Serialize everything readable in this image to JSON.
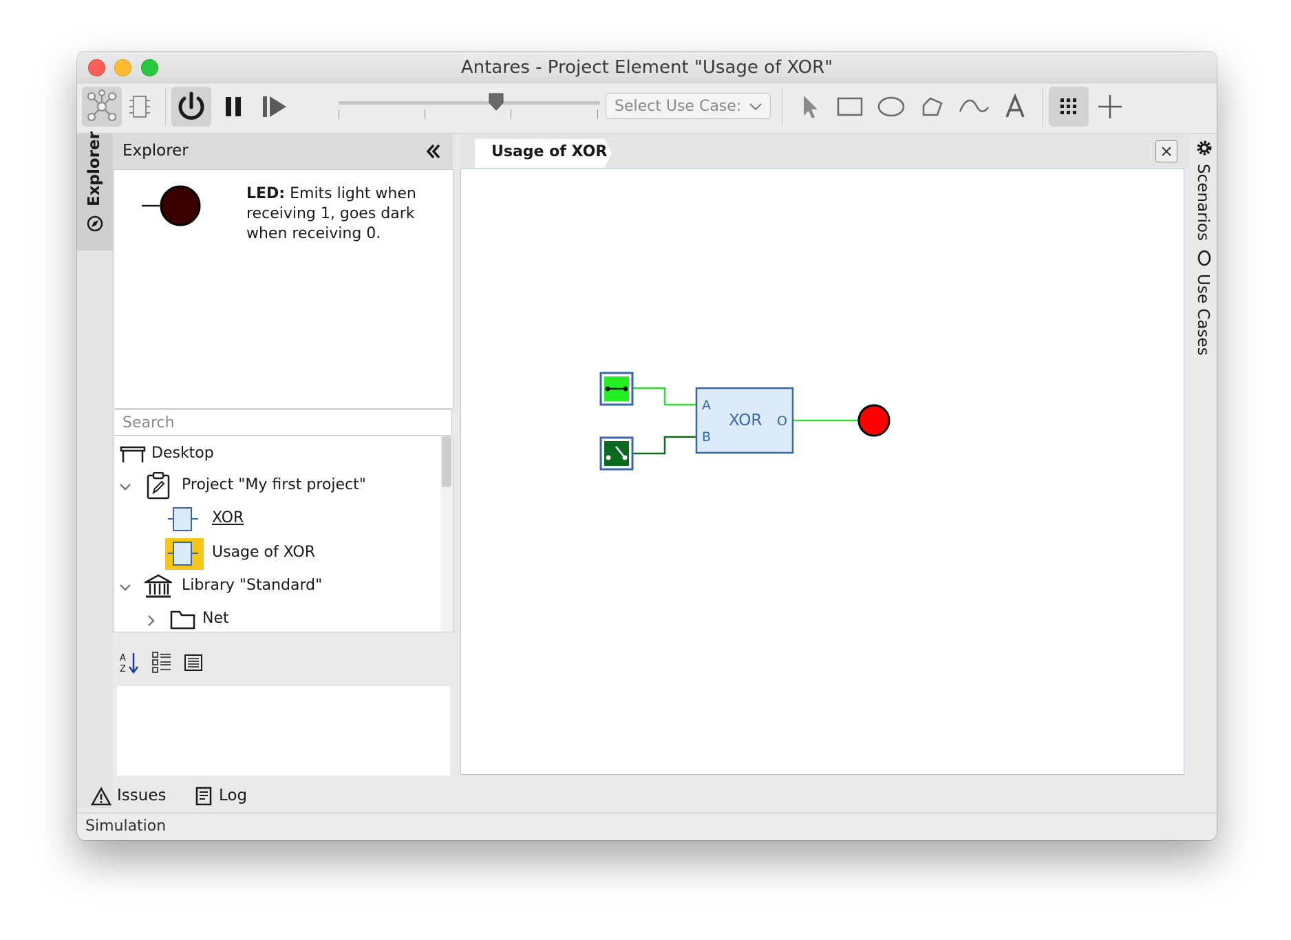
{
  "window": {
    "title": "Antares - Project Element \"Usage of XOR\""
  },
  "toolbar": {
    "icons": [
      "network-icon",
      "component-icon",
      "power-icon",
      "pause-icon",
      "step-icon",
      "pointer-icon",
      "rectangle-icon",
      "ellipse-icon",
      "polygon-icon",
      "curve-icon",
      "text-icon",
      "grid-icon",
      "crosshair-icon"
    ],
    "use_case_placeholder": "Select Use Case:"
  },
  "left_strip": {
    "explorer_tab_label": "Explorer"
  },
  "explorer": {
    "title": "Explorer",
    "preview": {
      "name": "LED:",
      "description": "Emits light when receiving 1, goes dark when receiving 0."
    },
    "search_placeholder": "Search",
    "tree": [
      {
        "label": "Desktop",
        "icon": "desktop-icon"
      },
      {
        "label": "Project \"My first project\"",
        "icon": "project-icon"
      },
      {
        "label": "XOR",
        "icon": "component-icon"
      },
      {
        "label": "Usage of XOR",
        "icon": "component-icon"
      },
      {
        "label": "Library \"Standard\"",
        "icon": "library-icon"
      },
      {
        "label": "Net",
        "icon": "folder-icon"
      }
    ]
  },
  "bottom_tabs": {
    "issues": "Issues",
    "log": "Log"
  },
  "status": {
    "text": "Simulation"
  },
  "editor": {
    "tab_label": "Usage of XOR",
    "gate": {
      "name": "XOR",
      "input_a": "A",
      "input_b": "B",
      "output": "O"
    },
    "colors": {
      "active_wire": "#33dd33",
      "inactive_wire": "#0a6a20",
      "led_on": "#ff0000",
      "gate_fill": "#dcebf8",
      "gate_border": "#3a66a8"
    }
  },
  "right_strip": {
    "scenarios": "Scenarios",
    "use_cases": "Use Cases"
  }
}
